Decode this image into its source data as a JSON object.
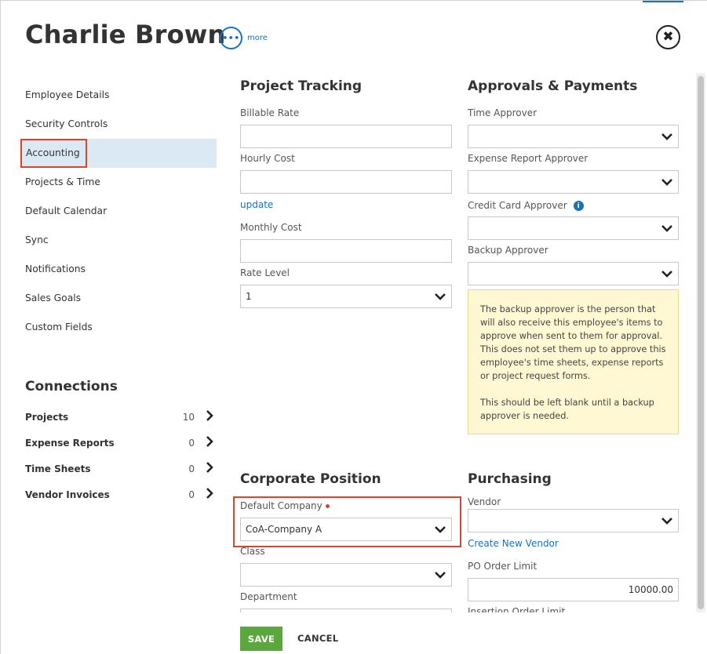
{
  "header": {
    "title": "Charlie Brown",
    "more_icon_glyph": "•••",
    "more_label": "more",
    "close_glyph": "✖"
  },
  "sidebar": {
    "items": [
      {
        "label": "Employee Details"
      },
      {
        "label": "Security Controls"
      },
      {
        "label": "Accounting",
        "active": true
      },
      {
        "label": "Projects & Time"
      },
      {
        "label": "Default Calendar"
      },
      {
        "label": "Sync"
      },
      {
        "label": "Notifications"
      },
      {
        "label": "Sales Goals"
      },
      {
        "label": "Custom Fields"
      }
    ]
  },
  "connections": {
    "title": "Connections",
    "items": [
      {
        "label": "Projects",
        "count": "10"
      },
      {
        "label": "Expense Reports",
        "count": "0"
      },
      {
        "label": "Time Sheets",
        "count": "0"
      },
      {
        "label": "Vendor Invoices",
        "count": "0"
      }
    ]
  },
  "project_tracking": {
    "title": "Project Tracking",
    "billable_rate_label": "Billable Rate",
    "billable_rate_value": "",
    "hourly_cost_label": "Hourly Cost",
    "hourly_cost_value": "",
    "update_link": "update",
    "monthly_cost_label": "Monthly Cost",
    "monthly_cost_value": "",
    "rate_level_label": "Rate Level",
    "rate_level_value": "1"
  },
  "approvals": {
    "title": "Approvals & Payments",
    "time_approver_label": "Time Approver",
    "time_approver_value": "",
    "expense_report_approver_label": "Expense Report Approver",
    "expense_report_approver_value": "",
    "credit_card_approver_label": "Credit Card Approver",
    "credit_card_approver_value": "",
    "info_glyph": "i",
    "backup_approver_label": "Backup Approver",
    "backup_approver_value": "",
    "note_paragraph_1": "The backup approver is the person that will also receive this employee's items to approve when sent to them for approval. This does not set them up to approve this employee's time sheets, expense reports or project request forms.",
    "note_paragraph_2": "This should be left blank until a backup approver is needed."
  },
  "corporate_position": {
    "title": "Corporate Position",
    "default_company_label": "Default Company",
    "default_company_value": "CoA-Company A",
    "class_label": "Class",
    "class_value": "",
    "department_label": "Department",
    "department_value": ""
  },
  "purchasing": {
    "title": "Purchasing",
    "vendor_label": "Vendor",
    "vendor_value": "",
    "create_vendor_link": "Create New Vendor",
    "po_order_limit_label": "PO Order Limit",
    "po_order_limit_value": "10000.00",
    "insertion_order_limit_label": "Insertion Order Limit"
  },
  "footer": {
    "save_label": "SAVE",
    "cancel_label": "CANCEL"
  },
  "colors": {
    "accent": "#1a73b8",
    "highlight": "#d9442a",
    "save_green": "#5aa83b",
    "active_nav_bg": "#dbe9f5",
    "note_bg": "#fff8d2"
  }
}
